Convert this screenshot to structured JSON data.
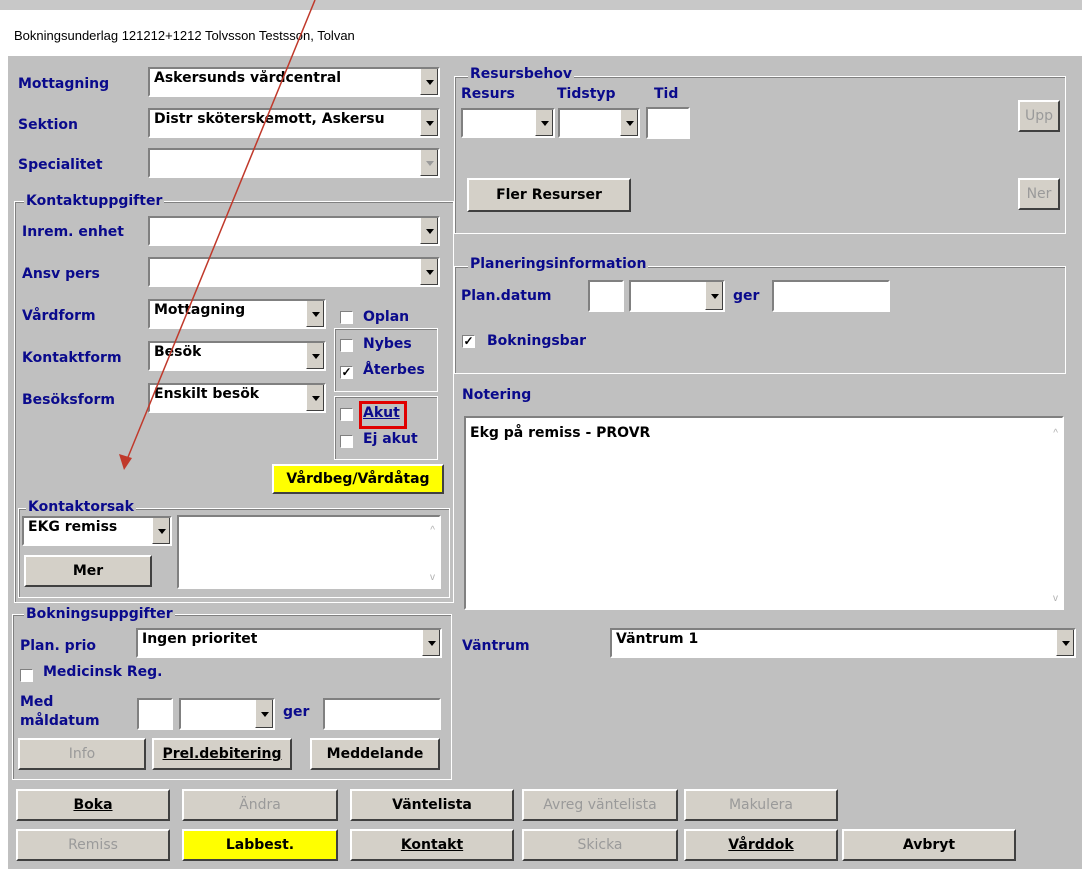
{
  "window": {
    "title": "Bokningsunderlag  121212+1212 Tolvsson Testsson, Tolvan"
  },
  "left": {
    "mottagning": {
      "label": "Mottagning",
      "value": "Askersunds vårdcentral"
    },
    "sektion": {
      "label": "Sektion",
      "value": "Distr sköterskemott, Askersu"
    },
    "specialitet": {
      "label": "Specialitet",
      "value": ""
    },
    "kontakt_group": "Kontaktuppgifter",
    "inrem": {
      "label": "Inrem. enhet",
      "value": ""
    },
    "ansv": {
      "label": "Ansv pers",
      "value": ""
    },
    "vardform": {
      "label": "Vårdform",
      "value": "Mottagning"
    },
    "kontaktform": {
      "label": "Kontaktform",
      "value": "Besök"
    },
    "besoksform": {
      "label": "Besöksform",
      "value": "Enskilt besök"
    },
    "checks": {
      "oplan": {
        "label": "Oplan",
        "checked": false
      },
      "nybes": {
        "label": "Nybes",
        "checked": false
      },
      "aterbes": {
        "label": "Återbes",
        "checked": true
      },
      "akut": {
        "label": "Akut",
        "checked": false
      },
      "ejakut": {
        "label": "Ej akut",
        "checked": false
      }
    },
    "vardbeg_button": "Vårdbeg/Vårdåtag",
    "kontaktorsak_group": "Kontaktorsak",
    "kontaktorsak_value": "EKG remiss",
    "mer_button": "Mer",
    "bokning_group": "Bokningsuppgifter",
    "planprio": {
      "label": "Plan. prio",
      "value": "Ingen prioritet"
    },
    "medicinsk_reg": {
      "label": "Medicinsk Reg.",
      "checked": false
    },
    "med_label": "Med",
    "maldatum_label": "måldatum",
    "ger_label": "ger",
    "info_button": "Info",
    "prel_button": "Prel.debitering",
    "meddelande_button": "Meddelande"
  },
  "right": {
    "resursbehov_group": "Resursbehov",
    "resurs_label": "Resurs",
    "tidstyp_label": "Tidstyp",
    "tid_label": "Tid",
    "upp_button": "Upp",
    "ner_button": "Ner",
    "fler_button": "Fler Resurser",
    "planering_group": "Planeringsinformation",
    "plandatum_label": "Plan.datum",
    "ger_label": "ger",
    "bokningsbar": {
      "label": "Bokningsbar",
      "checked": true
    },
    "notering_label": "Notering",
    "notering_text": "Ekg på remiss - PROVR",
    "vantrum_label": "Väntrum",
    "vantrum_value": "Väntrum 1"
  },
  "bottom": {
    "row1": [
      "Boka",
      "Ändra",
      "Väntelista",
      "Avreg väntelista",
      "Makulera"
    ],
    "row2": [
      "Remiss",
      "Labbest.",
      "Kontakt",
      "Skicka",
      "Vårddok",
      "Avbryt"
    ]
  },
  "colors": {
    "highlight": "#ffff00",
    "label_blue": "#0a0a8c",
    "annotation_red": "#c0392b"
  }
}
